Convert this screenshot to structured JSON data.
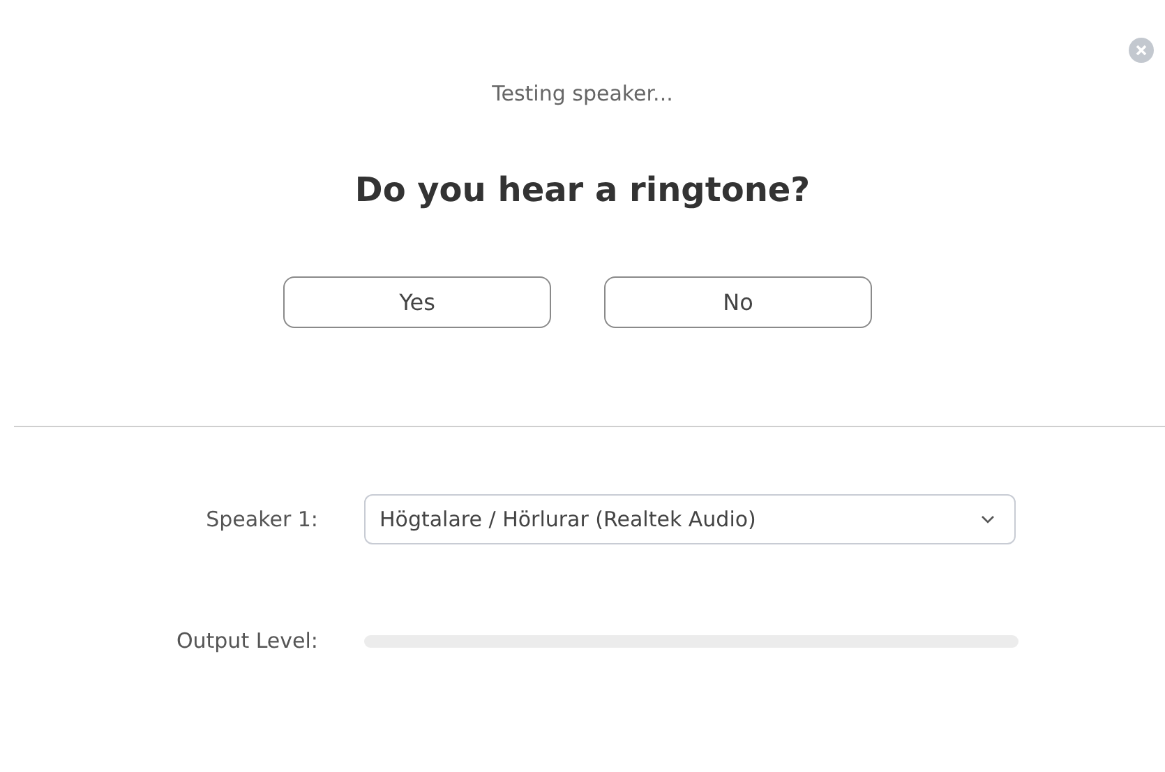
{
  "status": "Testing speaker...",
  "question": "Do you hear a ringtone?",
  "buttons": [
    {
      "label": "Yes"
    },
    {
      "label": "No"
    }
  ],
  "speaker": {
    "label": "Speaker 1:",
    "value": "Högtalare / Hörlurar (Realtek Audio)"
  },
  "output": {
    "label": "Output Level:",
    "level": 0
  }
}
